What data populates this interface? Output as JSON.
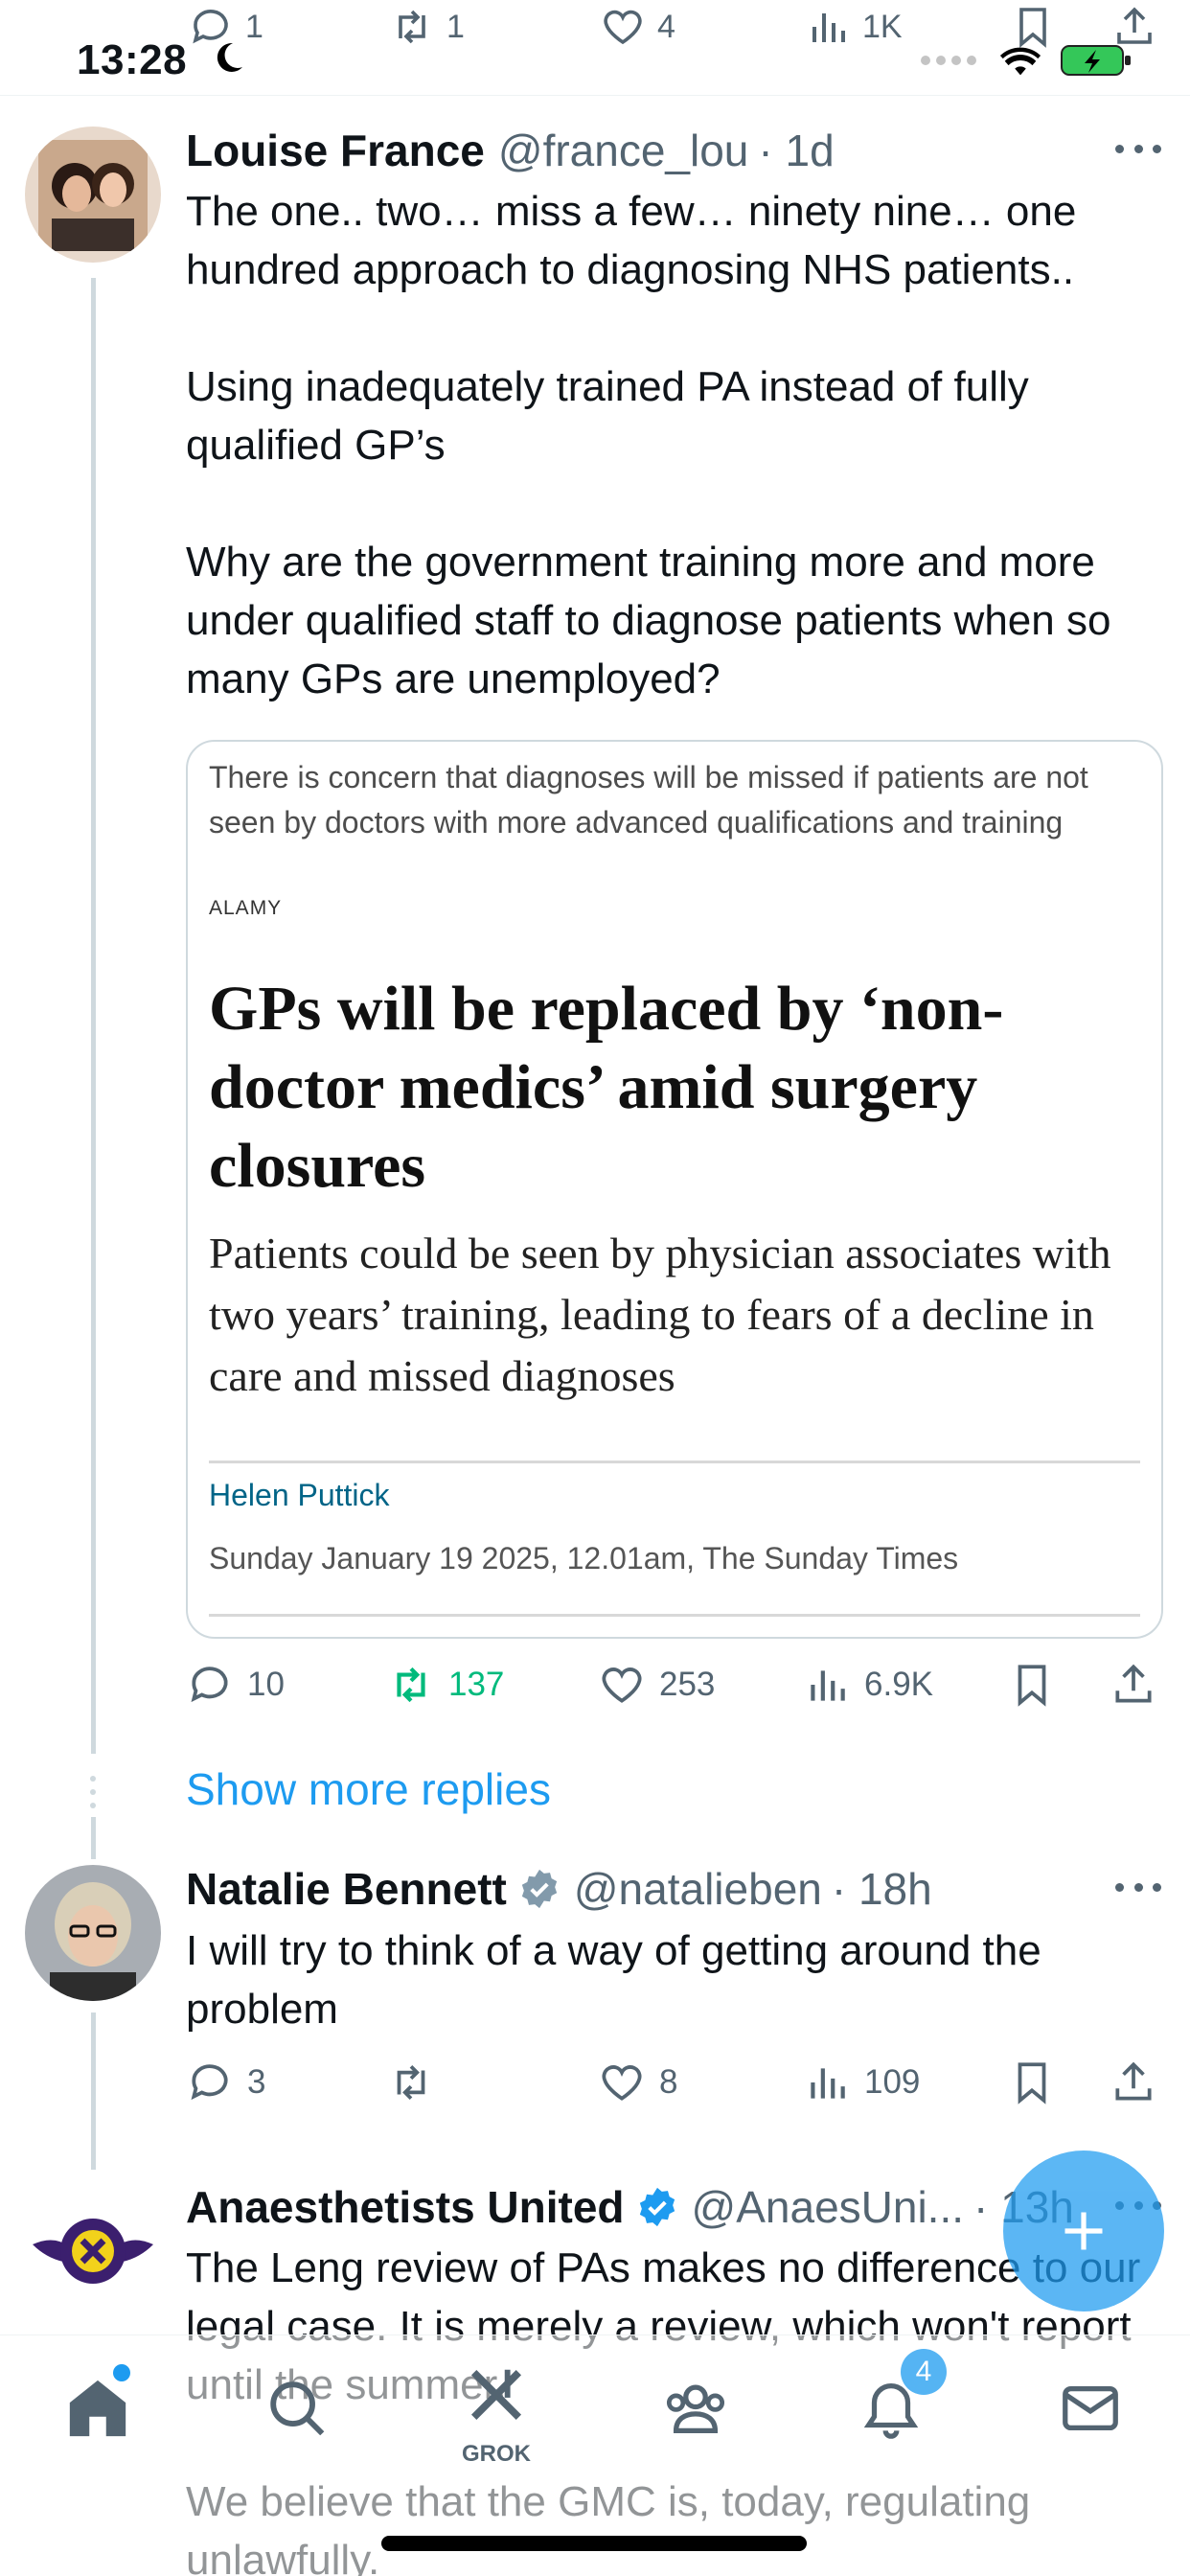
{
  "status_bar": {
    "time": "13:28"
  },
  "prev_actions": {
    "replies": "1",
    "reposts": "1",
    "likes": "4",
    "views": "1K"
  },
  "tweets": [
    {
      "name": "Louise France",
      "handle": "@france_lou",
      "time": "· 1d",
      "text": "The one.. two… miss a few… ninety nine… one hundred approach to diagnosing NHS patients..\n\nUsing inadequately trained PA instead of fully qualified GP’s\n\nWhy are the government training more and more under qualified staff to diagnose patients when so many GPs are unemployed?",
      "card": {
        "caption": "There is concern that diagnoses will be missed if patients are not seen by doctors with more advanced qualifications and training",
        "credit": "ALAMY",
        "headline": "GPs will be replaced by ‘non-doctor medics’ amid surgery closures",
        "standfirst": "Patients could be seen by physician associates with two years’ training, leading to fears of a decline in care and missed diagnoses",
        "byline": "Helen Puttick",
        "dateline": "Sunday January 19 2025, 12.01am, The Sunday Times"
      },
      "replies": "10",
      "reposts": "137",
      "likes": "253",
      "views": "6.9K"
    },
    {
      "name": "Natalie Bennett",
      "handle": "@natalieben",
      "time": "· 18h",
      "text": "I will try to think of a way of getting around the problem",
      "replies": "3",
      "reposts": "",
      "likes": "8",
      "views": "109"
    },
    {
      "name": "Anaesthetists United",
      "handle": "@AnaesUni...",
      "time": "· 13h",
      "text": "The Leng review of PAs makes no difference to our legal case. It is merely a review, which won't report until the summer.\n\nWe believe that the GMC is, today, regulating unlawfully."
    }
  ],
  "show_more_replies": "Show more replies",
  "nav": {
    "grok_label": "GROK",
    "notifications_badge": "4"
  },
  "colors": {
    "accent": "#1d9bf0",
    "repost_active": "#00ba7c",
    "muted": "#536471"
  }
}
